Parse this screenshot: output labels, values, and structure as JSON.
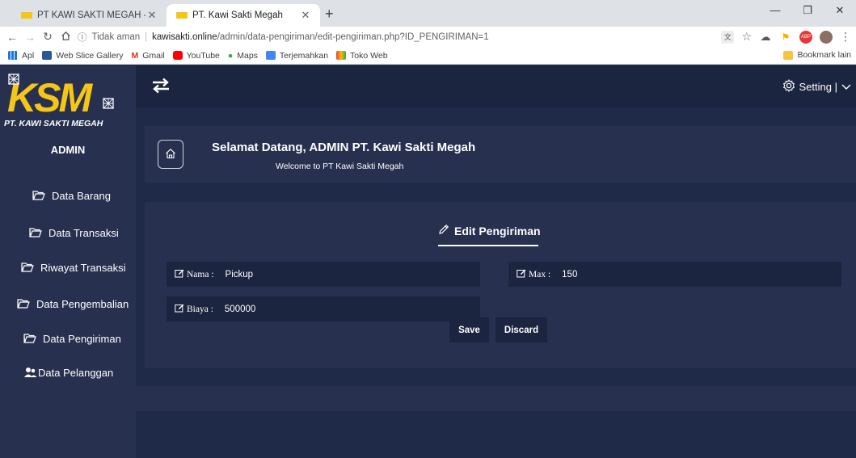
{
  "browser": {
    "tabs": [
      {
        "title": "PT KAWI SAKTI MEGAH - Constru",
        "active": false
      },
      {
        "title": "PT. Kawi Sakti Megah",
        "active": true
      }
    ],
    "address": {
      "security": "Tidak aman",
      "host": "kawisakti.online",
      "path": "/admin/data-pengiriman/edit-pengiriman.php?ID_PENGIRIMAN=1"
    },
    "bookmarks": [
      "Apl",
      "Web Slice Gallery",
      "Gmail",
      "YouTube",
      "Maps",
      "Terjemahkan",
      "Toko Web"
    ],
    "bookmarks_other": "Bookmark lain"
  },
  "sidebar": {
    "logo_text": "KSM",
    "logo_subtitle": "PT. KAWI SAKTI MEGAH",
    "user": "ADMIN",
    "items": [
      {
        "label": "Data Barang",
        "icon": "folder-open-icon"
      },
      {
        "label": "Data Transaksi",
        "icon": "folder-open-icon"
      },
      {
        "label": "Riwayat Transaksi",
        "icon": "folder-open-icon"
      },
      {
        "label": "Data Pengembalian",
        "icon": "folder-open-icon"
      },
      {
        "label": "Data Pengiriman",
        "icon": "folder-open-icon"
      },
      {
        "label": "Data Pelanggan",
        "icon": "users-icon"
      }
    ]
  },
  "topbar": {
    "setting_label": "Setting |"
  },
  "welcome": {
    "title": "Selamat Datang, ADMIN PT. Kawi Sakti Megah",
    "subtitle": "Welcome to PT Kawi Sakti Megah"
  },
  "form": {
    "title": "Edit Pengiriman",
    "fields": {
      "nama": {
        "label": "Nama :",
        "value": "Pickup"
      },
      "max": {
        "label": "Max :",
        "value": "150"
      },
      "biaya": {
        "label": "Biaya :",
        "value": "500000"
      }
    },
    "save_label": "Save",
    "discard_label": "Discard"
  },
  "colors": {
    "sidebar_bg": "#27304f",
    "page_bg": "#1e2a47",
    "field_bg": "#1c2540",
    "logo_yellow": "#f5c518"
  }
}
